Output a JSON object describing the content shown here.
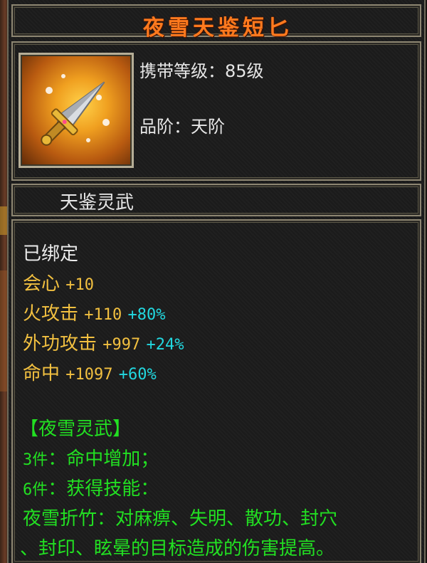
{
  "item": {
    "name": "夜雪天鉴短匕",
    "level_label": "携带等级：",
    "level_value": "85级",
    "grade_label": "品阶：",
    "grade_value": "天阶",
    "category": "天鉴灵武",
    "icon": "dagger-icon"
  },
  "attributes": {
    "bound": "已绑定",
    "stats": [
      {
        "name": "会心",
        "base": "+10",
        "bonus": ""
      },
      {
        "name": "火攻击",
        "base": "+110",
        "bonus": "+80%"
      },
      {
        "name": "外功攻击",
        "base": "+997",
        "bonus": "+24%"
      },
      {
        "name": "命中",
        "base": "+1097",
        "bonus": "+60%"
      }
    ]
  },
  "set": {
    "name": "【夜雪灵武】",
    "bonus3_count": "3件",
    "bonus3_text": "：命中增加；",
    "bonus6_count": "6件",
    "bonus6_text": "：获得技能：",
    "skill_line1": "夜雪折竹：对麻痹、失明、散功、封穴",
    "skill_line2": "、封印、眩晕的目标造成的伤害提高。"
  },
  "colors": {
    "title": "#ff7a1e",
    "stat_yellow": "#f2c040",
    "bonus_cyan": "#22d8e0",
    "set_green": "#22e022"
  }
}
